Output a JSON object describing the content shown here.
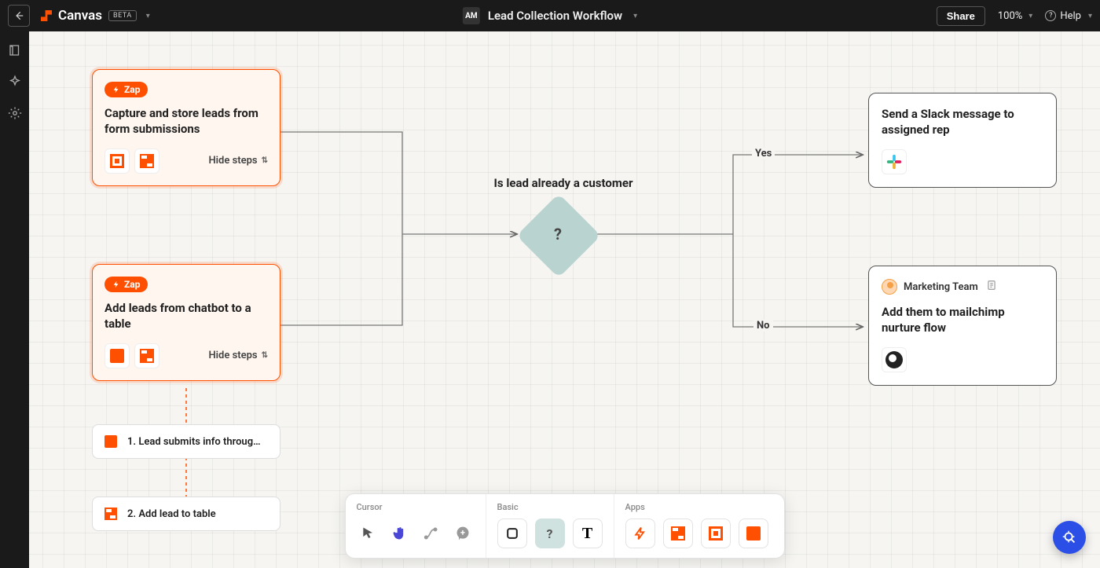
{
  "header": {
    "brand": "Canvas",
    "badge": "BETA",
    "avatar": "AM",
    "title": "Lead Collection Workflow",
    "share": "Share",
    "zoom": "100%",
    "help": "Help"
  },
  "nodes": {
    "zap1": {
      "badge": "Zap",
      "title": "Capture and store leads from form submissions",
      "hide": "Hide steps"
    },
    "zap2": {
      "badge": "Zap",
      "title": "Add leads from chatbot to a table",
      "hide": "Hide steps"
    },
    "step1": "1. Lead submits info throug…",
    "step2": "2. Add lead to table",
    "decision_label": "Is lead already a customer",
    "decision_mark": "?",
    "yes": "Yes",
    "no": "No",
    "outcome_yes": "Send a Slack message to assigned rep",
    "outcome_no_owner": "Marketing Team",
    "outcome_no_title": "Add them to mailchimp nurture flow"
  },
  "toolbar": {
    "groups": {
      "cursor": "Cursor",
      "basic": "Basic",
      "apps": "Apps"
    }
  }
}
